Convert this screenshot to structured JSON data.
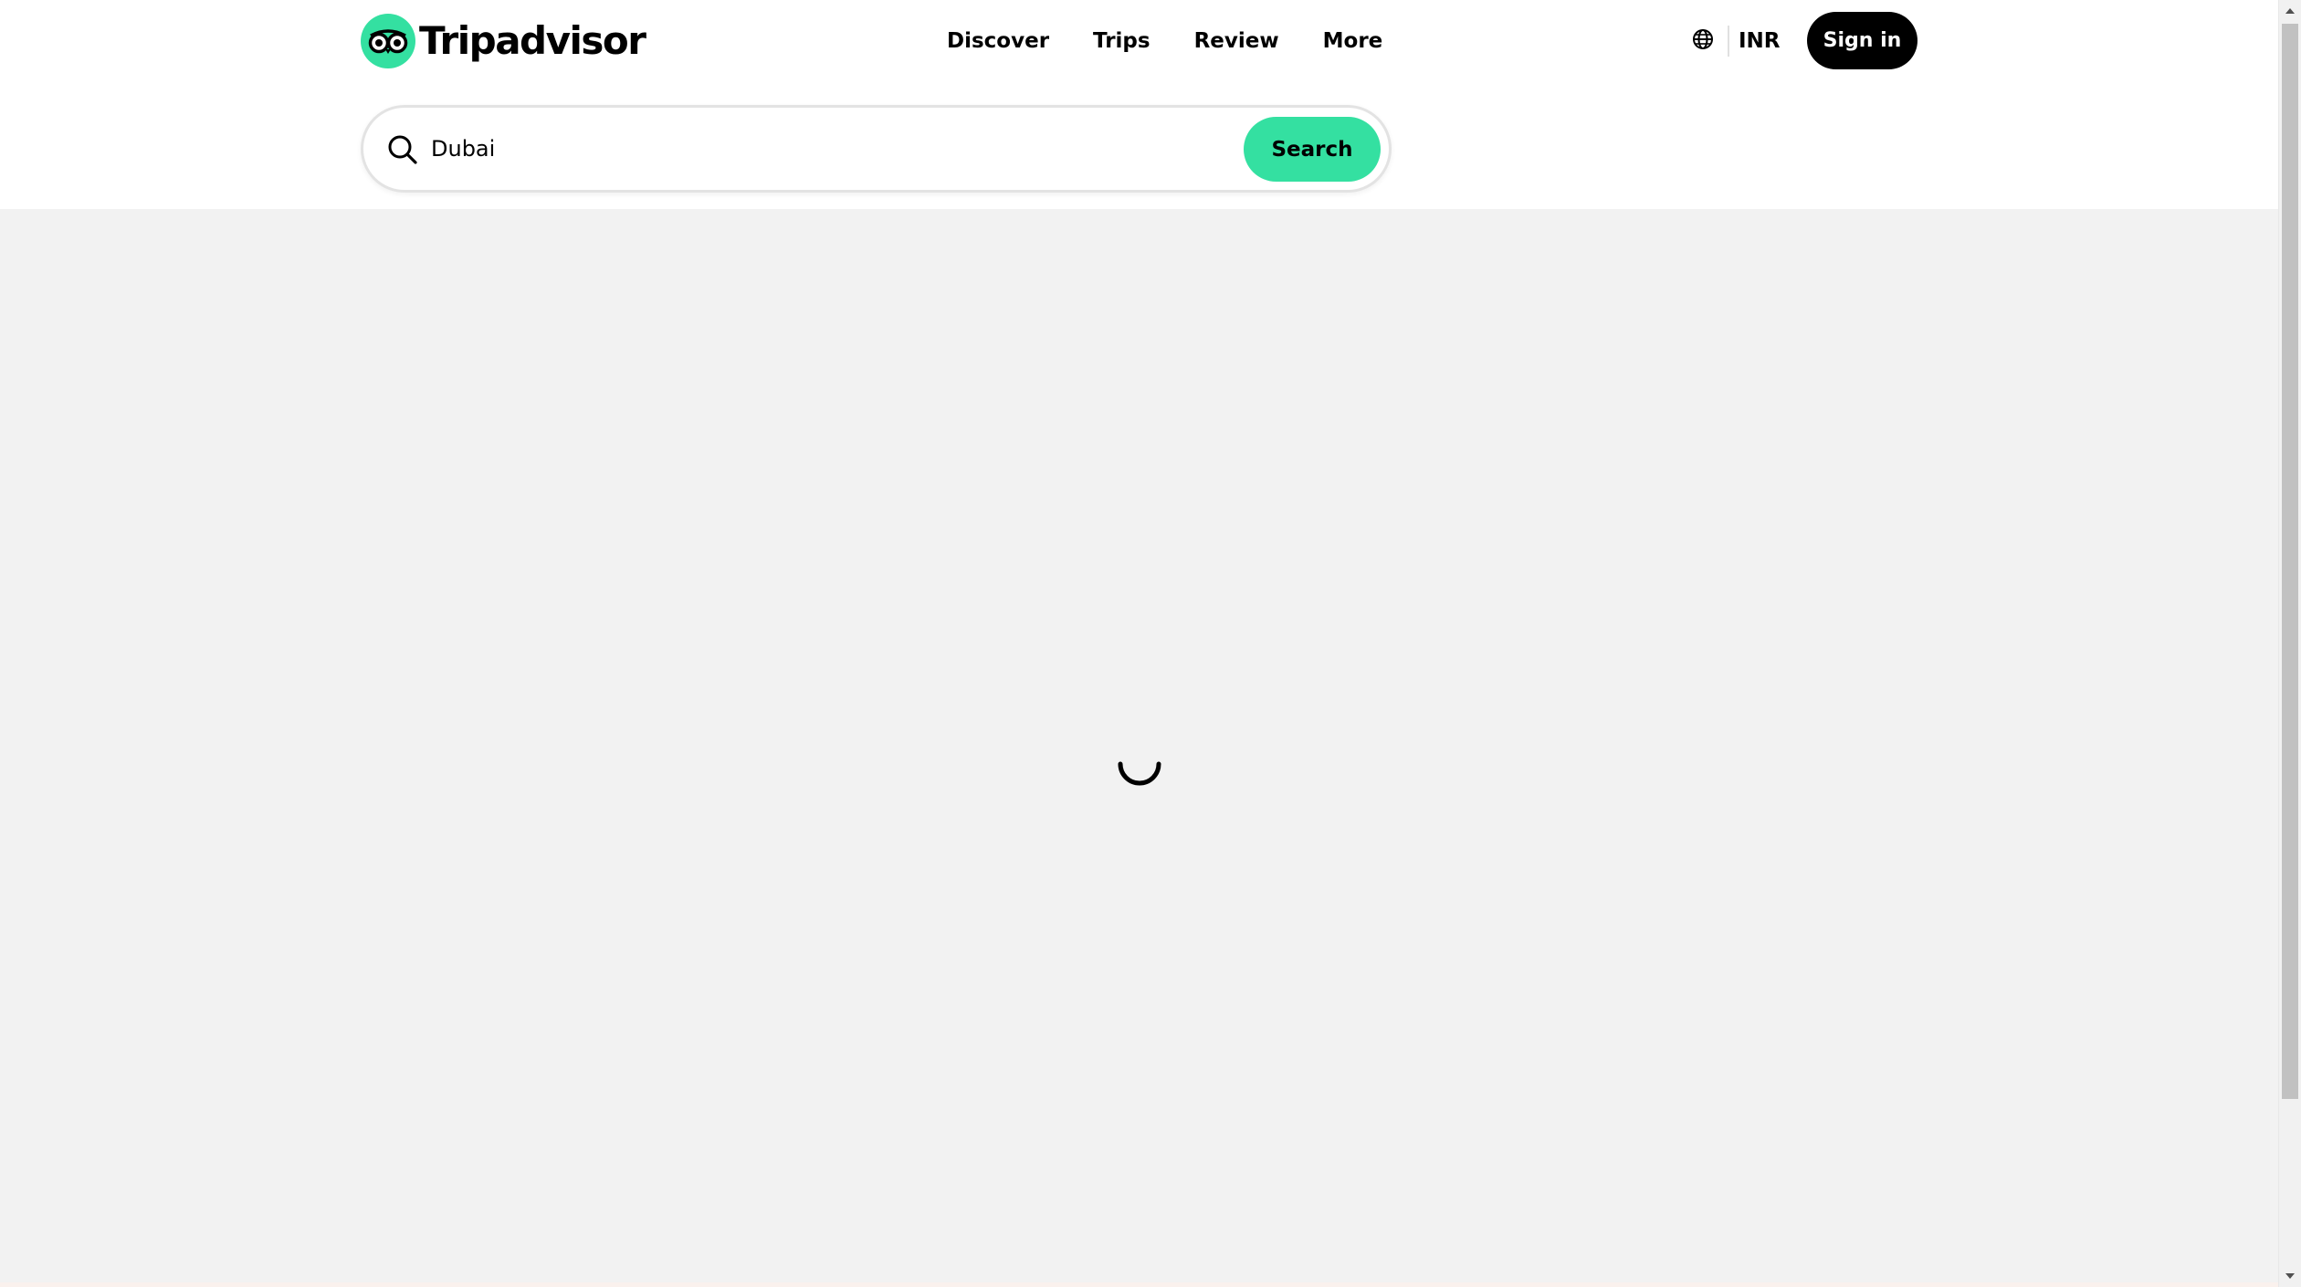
{
  "header": {
    "brand": "Tripadvisor",
    "nav": [
      "Discover",
      "Trips",
      "Review",
      "More"
    ],
    "currency": "INR",
    "signin_label": "Sign in"
  },
  "search": {
    "value": "Dubai",
    "button_label": "Search"
  },
  "icons": {
    "logo": "tripadvisor-owl-icon",
    "search": "search-icon",
    "language": "globe-icon",
    "loading": "loading-spinner-icon"
  },
  "colors": {
    "brand_green": "#34e0a1",
    "signin_bg": "#000000",
    "page_bg": "#f2f2f2",
    "header_bg": "#ffffff"
  }
}
